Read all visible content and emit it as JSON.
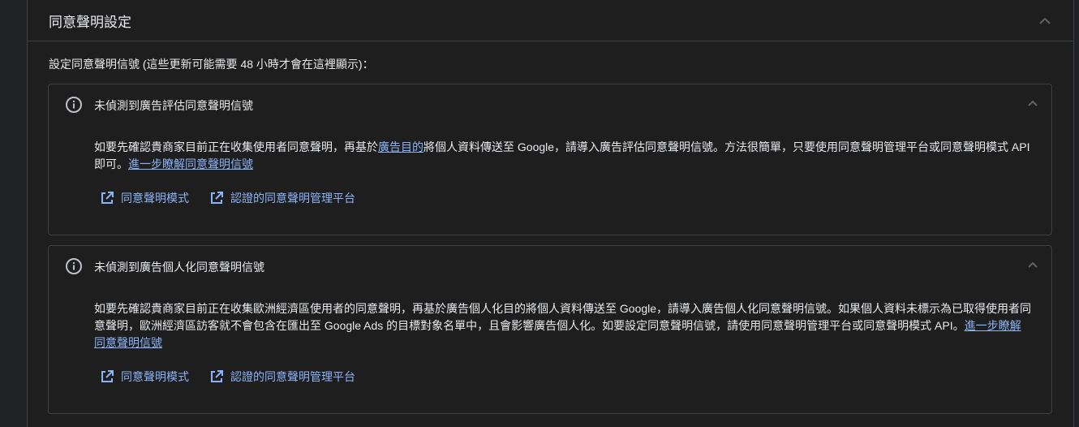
{
  "section": {
    "title": "同意聲明設定",
    "intro": "設定同意聲明信號 (這些更新可能需要 48 小時才會在這裡顯示)："
  },
  "cards": [
    {
      "title": "未偵測到廣告評估同意聲明信號",
      "body_pre": "如要先確認貴商家目前正在收集使用者同意聲明，再基於",
      "body_link": "廣告目的",
      "body_post": "將個人資料傳送至 Google，請導入廣告評估同意聲明信號。方法很簡單，只要使用同意聲明管理平台或同意聲明模式 API 即可。",
      "learn_more": "進一步瞭解同意聲明信號",
      "buttons": [
        "同意聲明模式",
        "認證的同意聲明管理平台"
      ]
    },
    {
      "title": "未偵測到廣告個人化同意聲明信號",
      "body_pre": "如要先確認貴商家目前正在收集歐洲經濟區使用者的同意聲明，再基於廣告個人化目的將個人資料傳送至 Google，請導入廣告個人化同意聲明信號。如果個人資料未標示為已取得使用者同意聲明，歐洲經濟區訪客就不會包含在匯出至 Google Ads 的目標對象名單中，且會影響廣告個人化。如要設定同意聲明信號，請使用同意聲明管理平台或同意聲明模式 API。",
      "learn_more": "進一步瞭解同意聲明信號",
      "buttons": [
        "同意聲明模式",
        "認證的同意聲明管理平台"
      ]
    }
  ],
  "icons": {
    "collapse": "chevron-up-icon",
    "info": "info-icon",
    "external": "open-in-new-icon"
  },
  "colors": {
    "link": "#8ab4f8",
    "border": "#3c4043",
    "text": "#e8eaed"
  }
}
